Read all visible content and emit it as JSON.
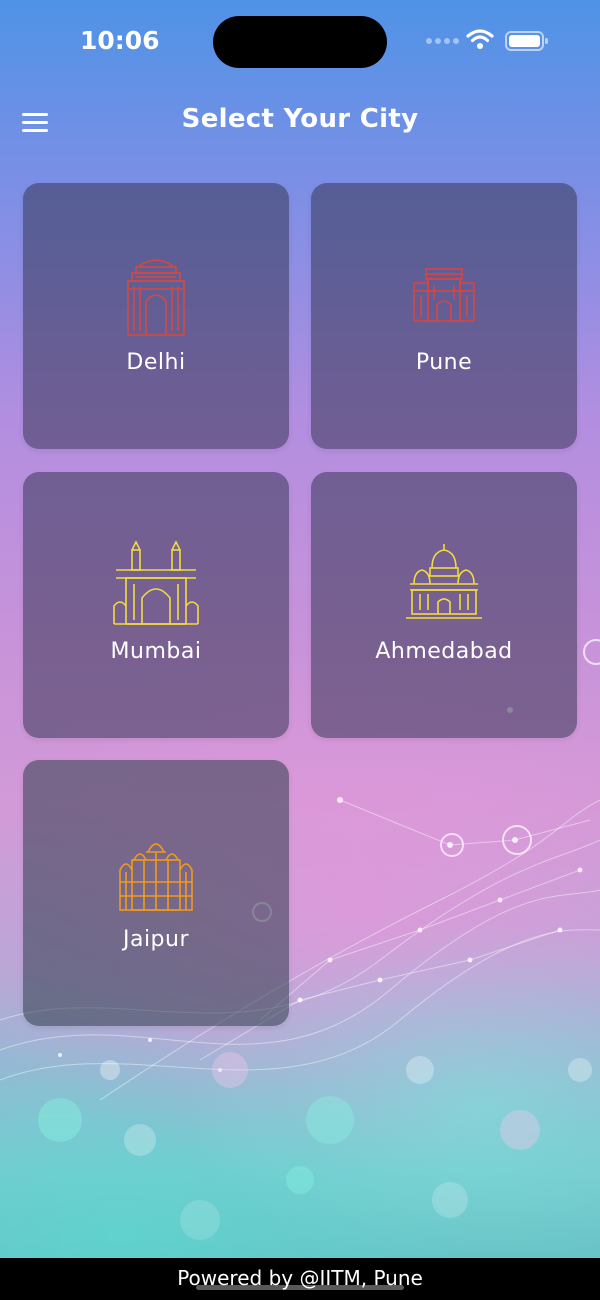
{
  "status_bar": {
    "time": "10:06"
  },
  "header": {
    "title": "Select Your City",
    "menu_icon": "hamburger-menu-icon"
  },
  "cities": [
    {
      "name": "Delhi",
      "icon": "india-gate-icon",
      "icon_color": "#d9483b"
    },
    {
      "name": "Pune",
      "icon": "shaniwar-wada-icon",
      "icon_color": "#e0433a"
    },
    {
      "name": "Mumbai",
      "icon": "gateway-of-india-icon",
      "icon_color": "#f2dc3c"
    },
    {
      "name": "Ahmedabad",
      "icon": "temple-dome-icon",
      "icon_color": "#f2dc3c"
    },
    {
      "name": "Jaipur",
      "icon": "hawa-mahal-icon",
      "icon_color": "#f29a1c"
    }
  ],
  "footer": {
    "text": "Powered by @IITM, Pune"
  },
  "colors": {
    "card_background": "#37375580",
    "footer_background": "#000000"
  }
}
